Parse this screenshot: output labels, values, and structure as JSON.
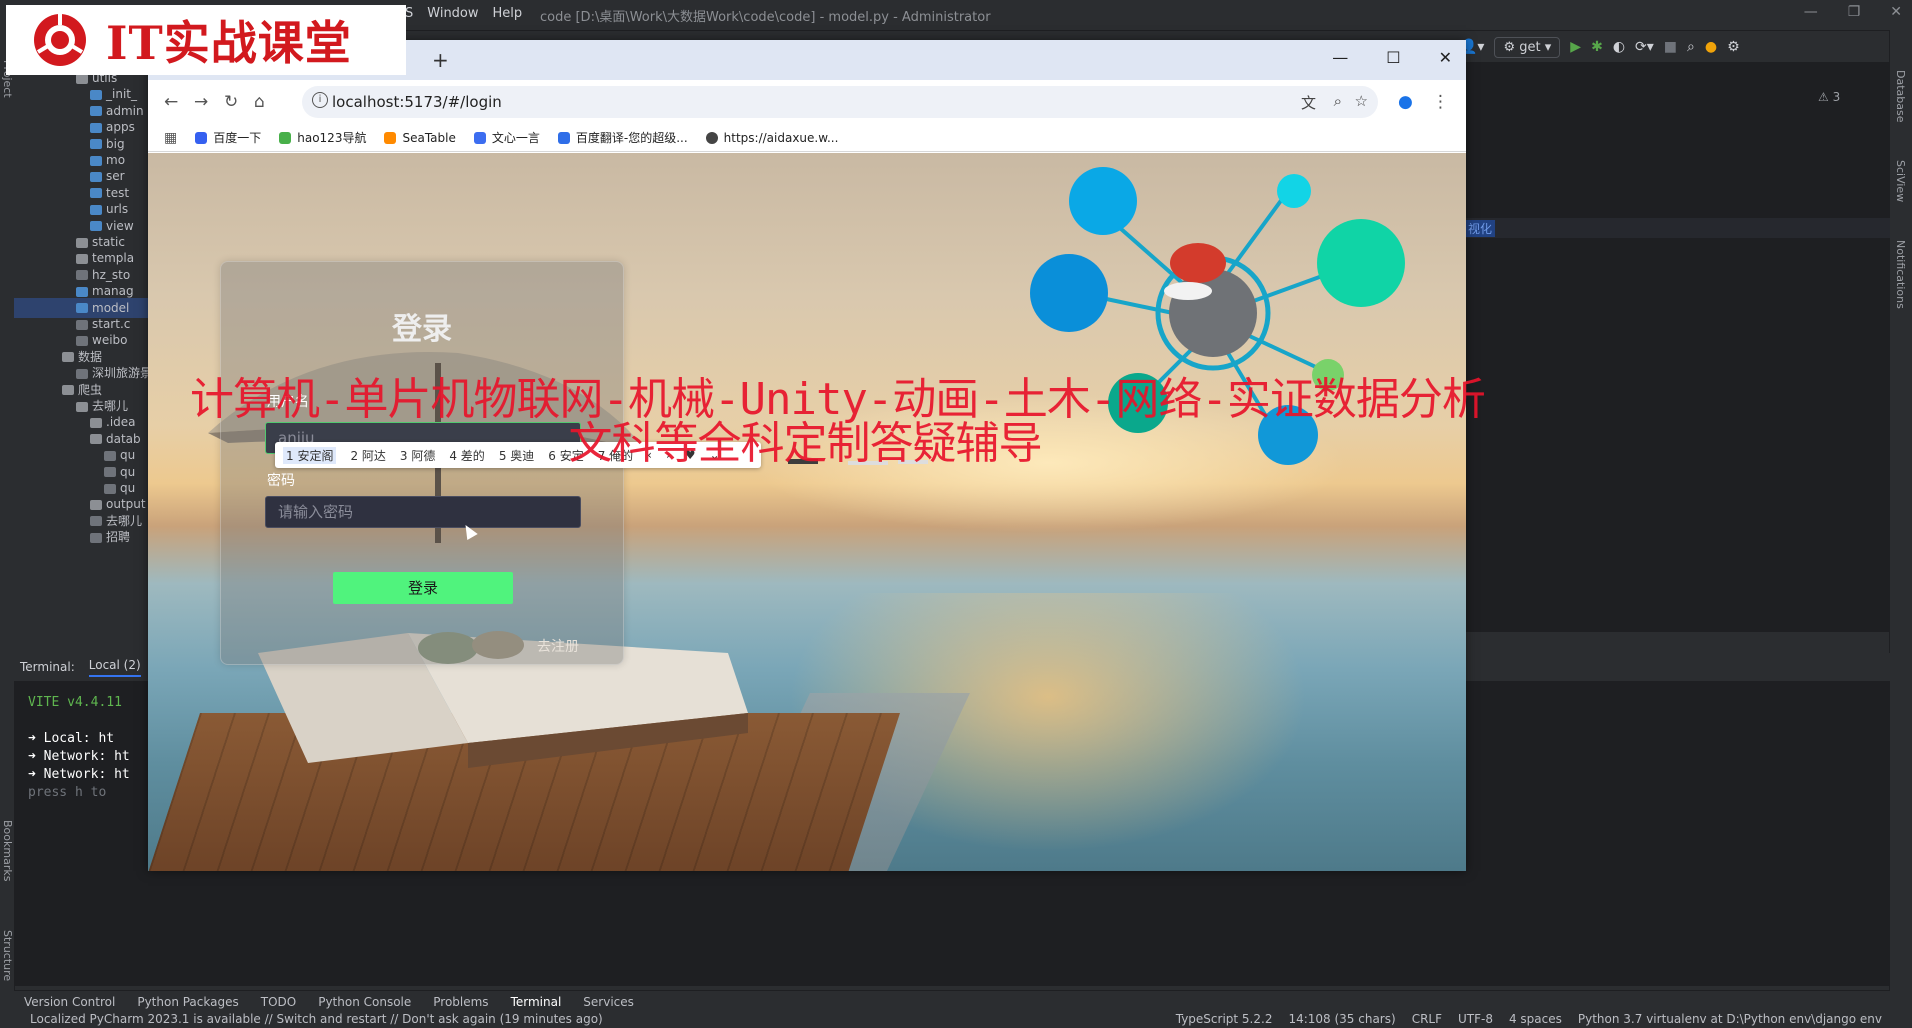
{
  "ide": {
    "menu": [
      "S",
      "Window",
      "Help"
    ],
    "title": "code [D:\\桌面\\Work\\大数据Work\\code\\code] - model.py - Administrator",
    "branch": "get",
    "warnings": "⚠ 3",
    "project_tree": [
      {
        "label": "utils",
        "indent": 0,
        "kind": "folder"
      },
      {
        "label": "_init_",
        "indent": 1,
        "kind": "py"
      },
      {
        "label": "admin",
        "indent": 1,
        "kind": "py"
      },
      {
        "label": "apps",
        "indent": 1,
        "kind": "py"
      },
      {
        "label": "big",
        "indent": 1,
        "kind": "py"
      },
      {
        "label": "mo",
        "indent": 1,
        "kind": "py"
      },
      {
        "label": "ser",
        "indent": 1,
        "kind": "py"
      },
      {
        "label": "test",
        "indent": 1,
        "kind": "py"
      },
      {
        "label": "urls",
        "indent": 1,
        "kind": "py"
      },
      {
        "label": "view",
        "indent": 1,
        "kind": "py"
      },
      {
        "label": "static",
        "indent": 0,
        "kind": "folder"
      },
      {
        "label": "templa",
        "indent": 0,
        "kind": "folder"
      },
      {
        "label": "hz_sto",
        "indent": 0,
        "kind": "file"
      },
      {
        "label": "manag",
        "indent": 0,
        "kind": "py"
      },
      {
        "label": "model",
        "indent": 0,
        "kind": "py",
        "selected": true
      },
      {
        "label": "start.c",
        "indent": 0,
        "kind": "file"
      },
      {
        "label": "weibo",
        "indent": 0,
        "kind": "file"
      },
      {
        "label": "数据",
        "indent": -1,
        "kind": "folder"
      },
      {
        "label": "深圳旅游景",
        "indent": 0,
        "kind": "file"
      },
      {
        "label": "爬虫",
        "indent": -1,
        "kind": "folder"
      },
      {
        "label": "去哪儿",
        "indent": 0,
        "kind": "folder"
      },
      {
        "label": ".idea",
        "indent": 1,
        "kind": "folder"
      },
      {
        "label": "datab",
        "indent": 1,
        "kind": "folder"
      },
      {
        "label": "qu",
        "indent": 2,
        "kind": "file"
      },
      {
        "label": "qu",
        "indent": 2,
        "kind": "file"
      },
      {
        "label": "qu",
        "indent": 2,
        "kind": "file"
      },
      {
        "label": "output",
        "indent": 1,
        "kind": "folder"
      },
      {
        "label": "去哪儿",
        "indent": 1,
        "kind": "file"
      },
      {
        "label": "招聘",
        "indent": 1,
        "kind": "file"
      }
    ],
    "editor_highlight": "视化",
    "terminal": {
      "tab_label": "Terminal:",
      "tab_local": "Local (2)",
      "lines": [
        {
          "text": "VITE v4.4.11",
          "color": "#5fb64f"
        },
        {
          "text": "➜  Local:   ht",
          "color": "#ffffff"
        },
        {
          "text": "➜  Network: ht",
          "color": "#ffffff"
        },
        {
          "text": "➜  Network: ht",
          "color": "#ffffff"
        },
        {
          "text": "   press h to",
          "color": "#6f737a"
        }
      ]
    },
    "bottom_tools": [
      "Version Control",
      "Python Packages",
      "TODO",
      "Python Console",
      "Problems",
      "Terminal",
      "Services"
    ],
    "status_left": "Localized PyCharm 2023.1 is available // Switch and restart // Don't ask again (19 minutes ago)",
    "status_right": [
      "TypeScript 5.2.2",
      "14:108 (35 chars)",
      "CRLF",
      "UTF-8",
      "4 spaces",
      "Python 3.7 virtualenv at D:\\Python env\\django env"
    ],
    "side_labels": {
      "left_top": "Project",
      "left_bottom_1": "Bookmarks",
      "left_bottom_2": "Structure",
      "right_1": "Database",
      "right_2": "SciView",
      "right_3": "Notifications"
    }
  },
  "brand": {
    "text": "IT实战课堂"
  },
  "browser": {
    "url": "localhost:5173/#/login",
    "bookmarks": [
      {
        "label": "百度一下",
        "color": "#3560f0"
      },
      {
        "label": "hao123导航",
        "color": "#48b04a"
      },
      {
        "label": "SeaTable",
        "color": "#ff8a00"
      },
      {
        "label": "文心一言",
        "color": "#3c6df0"
      },
      {
        "label": "百度翻译-您的超级...",
        "color": "#2f6ee8"
      },
      {
        "label": "https://aidaxue.w...",
        "color": "#444444"
      }
    ]
  },
  "login": {
    "title": "登录",
    "username_label": "用户名",
    "username_value": "anjiu",
    "password_label": "密码",
    "password_placeholder": "请输入密码",
    "submit_label": "登录",
    "register_link": "去注册",
    "ime_candidates": [
      "1 安定阁",
      "2 阿达",
      "3 阿德",
      "4 差的",
      "5 奥迪",
      "6 安定",
      "7 俺的"
    ]
  },
  "watermark": {
    "line1": "计算机-单片机物联网-机械-Unity-动画-土木-网络-实证数据分析",
    "line2": "文科等全科定制答疑辅导"
  }
}
